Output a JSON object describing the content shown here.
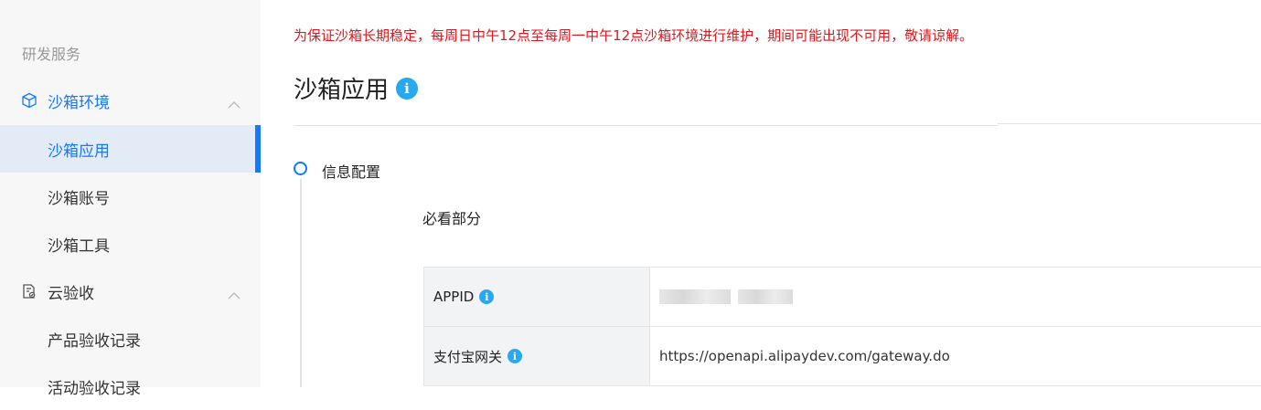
{
  "sidebar": {
    "group_label": "研发服务",
    "sections": [
      {
        "label": "沙箱环境",
        "items": [
          {
            "label": "沙箱应用"
          },
          {
            "label": "沙箱账号"
          },
          {
            "label": "沙箱工具"
          }
        ]
      },
      {
        "label": "云验收",
        "items": [
          {
            "label": "产品验收记录"
          },
          {
            "label": "活动验收记录"
          }
        ]
      }
    ]
  },
  "main": {
    "notice": "为保证沙箱长期稳定，每周日中午12点至每周一中午12点沙箱环境进行维护，期间可能出现不可用，敬请谅解。",
    "title": "沙箱应用",
    "step": {
      "label": "信息配置",
      "sub_label": "必看部分"
    },
    "table": {
      "rows": [
        {
          "label": "APPID",
          "value": ""
        },
        {
          "label": "支付宝网关",
          "value": "https://openapi.alipaydev.com/gateway.do"
        }
      ]
    }
  },
  "icons": {
    "info": "i"
  },
  "colors": {
    "accent": "#1677ff",
    "notice": "#e0161d",
    "info": "#27a8ef"
  }
}
